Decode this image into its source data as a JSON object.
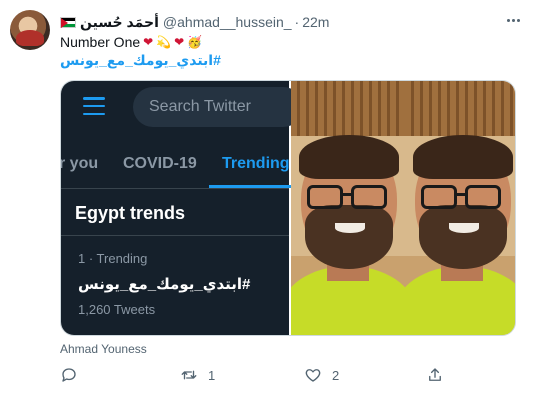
{
  "author": {
    "display_name": "أحمَد حُسين",
    "handle": "@ahmad__hussein_",
    "separator": "·",
    "time": "22m",
    "flag_icon": "palestine-flag-icon"
  },
  "tweet": {
    "text": "Number One",
    "emojis": [
      "❤",
      "💫",
      "❤",
      "🥳"
    ],
    "hashtag": "#ابتدي_يومك_مع_يونس"
  },
  "media": {
    "screenshot": {
      "search_placeholder": "Search Twitter",
      "tabs": [
        "r you",
        "COVID-19",
        "Trending"
      ],
      "active_tab": "Trending",
      "section_title": "Egypt trends",
      "trend_meta": "1 · Trending",
      "trend_name": "#ابتدي_يومك_مع_يونس",
      "trend_count": "1,260 Tweets"
    },
    "caption": "Ahmad Youness"
  },
  "actions": {
    "reply_count": "",
    "retweet_count": "1",
    "like_count": "2"
  },
  "colors": {
    "accent": "#1d9bf0",
    "dark_bg": "#15202b",
    "heart": "#d01535"
  }
}
